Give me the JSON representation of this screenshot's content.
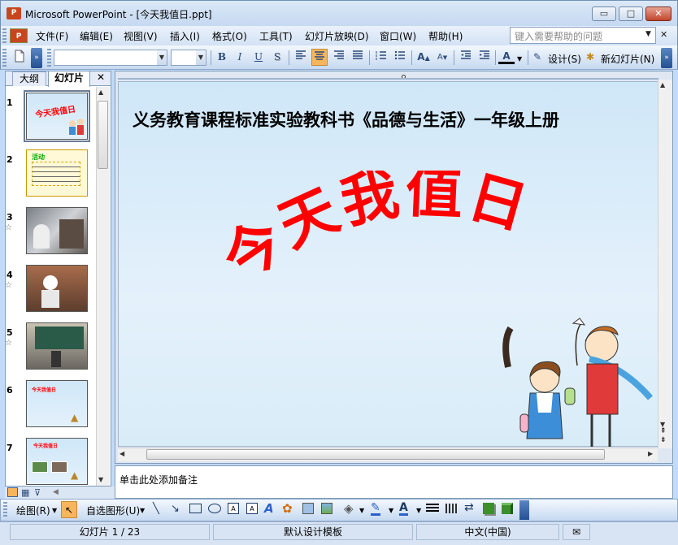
{
  "window": {
    "app_icon": "P",
    "title": "Microsoft PowerPoint - [今天我值日.ppt]",
    "minimize": "▭",
    "restore": "□",
    "close": "✕"
  },
  "menu": {
    "doc_icon": "P",
    "items": [
      "文件(F)",
      "编辑(E)",
      "视图(V)",
      "插入(I)",
      "格式(O)",
      "工具(T)",
      "幻灯片放映(D)",
      "窗口(W)",
      "帮助(H)"
    ],
    "help_placeholder": "键入需要帮助的问题",
    "doc_close": "✕"
  },
  "toolbar": {
    "bold": "B",
    "italic": "I",
    "underline": "U",
    "shadow": "S",
    "font_color": "A",
    "design": "设计(S)",
    "new_slide": "新幻灯片(N)",
    "grow_font": "A",
    "shrink_font": "A"
  },
  "outline": {
    "tab_outline": "大纲",
    "tab_slides": "幻灯片",
    "close": "✕",
    "slide_numbers": [
      "1",
      "2",
      "3",
      "4",
      "5",
      "6",
      "7"
    ],
    "star": "☆",
    "thumb1_text": "今天我值日",
    "thumb2_text": "活动",
    "thumb6_text": "今天我值日",
    "thumb7_text": "今天我值日"
  },
  "slide": {
    "heading": "义务教育课程标准实验教科书《品德与生活》一年级上册",
    "wordart": "今天我值日"
  },
  "notes": {
    "placeholder": "单击此处添加备注"
  },
  "draw_toolbar": {
    "draw": "绘图(R)",
    "autoshapes": "自选图形(U)",
    "font_color": "A"
  },
  "status": {
    "slide_info": "幻灯片 1 / 23",
    "template": "默认设计模板",
    "language": "中文(中国)"
  },
  "colors": {
    "wordart_red": "#ff0000",
    "accent_blue": "#c3daf9",
    "active_button": "#f7b65d"
  }
}
